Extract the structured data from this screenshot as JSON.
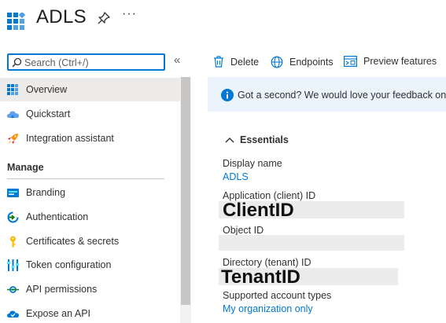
{
  "header": {
    "title": "ADLS",
    "more_label": "···"
  },
  "search": {
    "placeholder": "Search (Ctrl+/)",
    "collapse_label": "«"
  },
  "sidebar": {
    "items": [
      {
        "label": "Overview",
        "icon": "overview-grid-icon"
      },
      {
        "label": "Quickstart",
        "icon": "quickstart-cloud-icon"
      },
      {
        "label": "Integration assistant",
        "icon": "rocket-icon"
      }
    ],
    "manage_header": "Manage",
    "manage_items": [
      {
        "label": "Branding",
        "icon": "branding-icon"
      },
      {
        "label": "Authentication",
        "icon": "authentication-icon"
      },
      {
        "label": "Certificates & secrets",
        "icon": "key-icon"
      },
      {
        "label": "Token configuration",
        "icon": "token-bars-icon"
      },
      {
        "label": "API permissions",
        "icon": "api-permissions-icon"
      },
      {
        "label": "Expose an API",
        "icon": "cloud-api-icon"
      }
    ]
  },
  "toolbar": {
    "delete_label": "Delete",
    "endpoints_label": "Endpoints",
    "preview_label": "Preview features"
  },
  "banner": {
    "text": "Got a second? We would love your feedback on Micr"
  },
  "essentials": {
    "header": "Essentials",
    "display_name_label": "Display name",
    "display_name_value": "ADLS",
    "app_id_label": "Application (client) ID",
    "app_id_redaction": "ClientID",
    "object_id_label": "Object ID",
    "directory_id_label": "Directory (tenant) ID",
    "directory_id_redaction": "TenantID",
    "account_types_label": "Supported account types",
    "account_types_value": "My organization only"
  },
  "colors": {
    "accent": "#0078d4",
    "active_bg": "#edebe9",
    "banner_bg": "#ebf3fc"
  }
}
